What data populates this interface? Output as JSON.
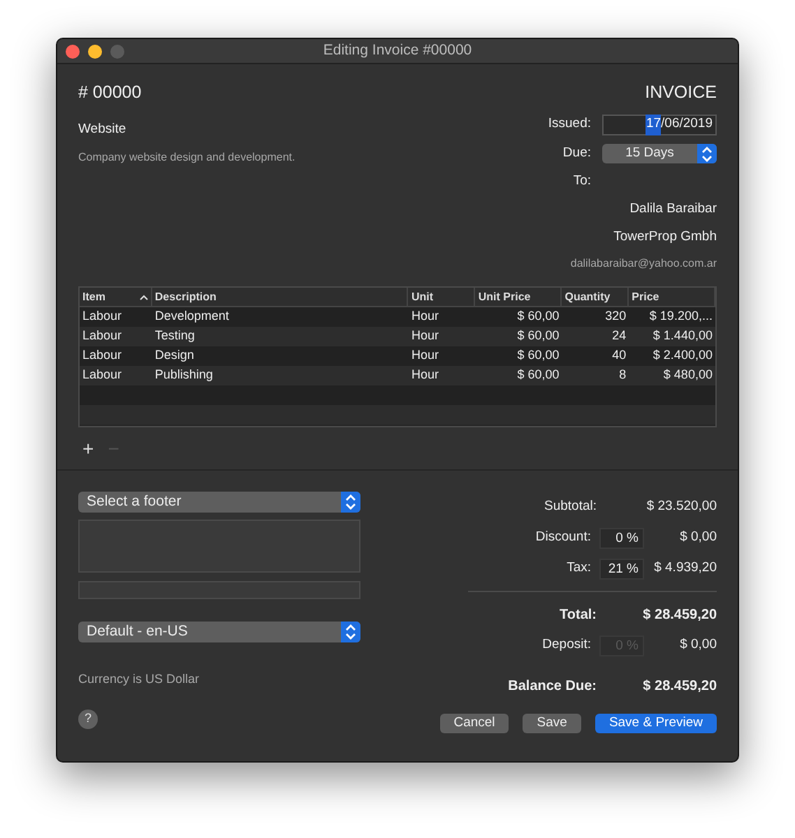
{
  "window": {
    "title": "Editing Invoice #00000"
  },
  "number": "# 00000",
  "doc_type": "INVOICE",
  "project": {
    "name": "Website",
    "description": "Company website design and development."
  },
  "issued": {
    "label": "Issued:",
    "segments": [
      {
        "text": "17",
        "selected": true
      },
      {
        "text": "/06/2019",
        "selected": false
      }
    ]
  },
  "due": {
    "label": "Due:",
    "value": "15 Days"
  },
  "to": {
    "label": "To:",
    "lines": [
      {
        "text": "Dalila Baraibar",
        "kind": "name"
      },
      {
        "text": "TowerProp Gmbh",
        "kind": "name"
      },
      {
        "text": "dalilabaraibar@yahoo.com.ar",
        "kind": "email"
      }
    ]
  },
  "table": {
    "columns": [
      {
        "label": "Item",
        "sorted": true
      },
      {
        "label": "Description",
        "sorted": false
      },
      {
        "label": "Unit",
        "sorted": false
      },
      {
        "label": "Unit Price",
        "sorted": false
      },
      {
        "label": "Quantity",
        "sorted": false
      },
      {
        "label": "Price",
        "sorted": false
      }
    ],
    "rows": [
      [
        "Labour",
        "Development",
        "Hour",
        "$ 60,00",
        "320",
        "$ 19.200,..."
      ],
      [
        "Labour",
        "Testing",
        "Hour",
        "$ 60,00",
        "24",
        "$ 1.440,00"
      ],
      [
        "Labour",
        "Design",
        "Hour",
        "$ 60,00",
        "40",
        "$ 2.400,00"
      ],
      [
        "Labour",
        "Publishing",
        "Hour",
        "$ 60,00",
        "8",
        "$ 480,00"
      ]
    ]
  },
  "table_buttons": [
    {
      "label": "+",
      "disabled": false
    },
    {
      "label": "−",
      "disabled": true
    }
  ],
  "footer_select": {
    "value": "Select a footer"
  },
  "locale_select": {
    "value": "Default - en-US"
  },
  "currency_note": "Currency is US Dollar",
  "totals": [
    {
      "kind": "plain",
      "label": "Subtotal:",
      "amount": "$ 23.520,00"
    },
    {
      "kind": "percent",
      "label": "Discount:",
      "percent": "0 %",
      "disabled": false,
      "amount": "$ 0,00"
    },
    {
      "kind": "percent",
      "label": "Tax:",
      "percent": "21 %",
      "disabled": false,
      "amount": "$ 4.939,20"
    },
    {
      "kind": "divider"
    },
    {
      "kind": "bold",
      "label": "Total:",
      "amount": "$ 28.459,20"
    },
    {
      "kind": "percent",
      "label": "Deposit:",
      "percent": "0 %",
      "disabled": true,
      "amount": "$ 0,00"
    },
    {
      "kind": "bold",
      "label": "Balance Due:",
      "amount": "$ 28.459,20"
    }
  ],
  "help_button": "?",
  "buttons": [
    {
      "label": "Cancel",
      "primary": false
    },
    {
      "label": "Save",
      "primary": false
    },
    {
      "label": "Save & Preview",
      "primary": true
    }
  ]
}
